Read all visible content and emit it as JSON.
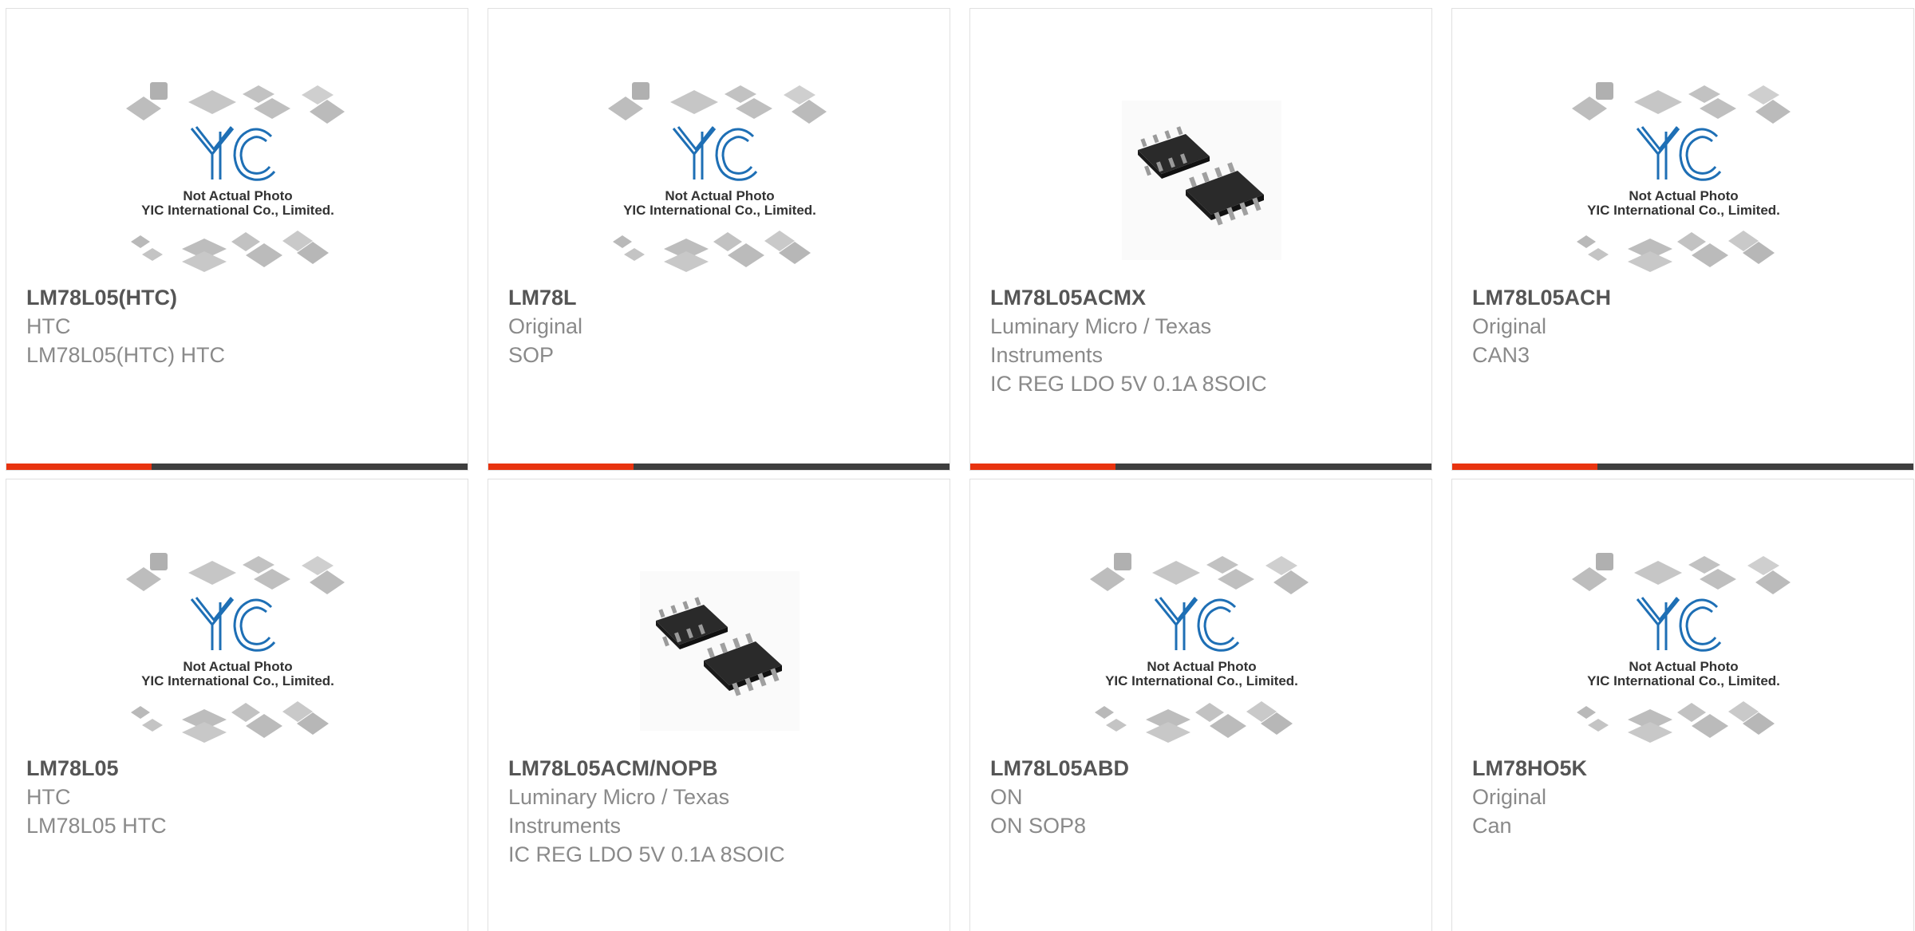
{
  "colors": {
    "accent": "#e8330f",
    "bar": "#3e3e3e",
    "title": "#555555",
    "text": "#8a8a8a",
    "yic_blue": "#1e6fb5"
  },
  "placeholder": {
    "line1": "Not Actual Photo",
    "line2": "YIC International Co., Limited.",
    "logo": "YIC"
  },
  "products": [
    {
      "part": "LM78L05(HTC)",
      "manufacturer": "HTC",
      "description": "LM78L05(HTC) HTC",
      "image": "placeholder"
    },
    {
      "part": "LM78L",
      "manufacturer": "Original",
      "description": "SOP",
      "image": "placeholder"
    },
    {
      "part": "LM78L05ACMX",
      "manufacturer": "Luminary Micro / Texas Instruments",
      "description": "IC REG LDO 5V 0.1A 8SOIC",
      "image": "soic"
    },
    {
      "part": "LM78L05ACH",
      "manufacturer": "Original",
      "description": "CAN3",
      "image": "placeholder"
    },
    {
      "part": "LM78L05",
      "manufacturer": "HTC",
      "description": "LM78L05 HTC",
      "image": "placeholder"
    },
    {
      "part": "LM78L05ACM/NOPB",
      "manufacturer": "Luminary Micro / Texas Instruments",
      "description": "IC REG LDO 5V 0.1A 8SOIC",
      "image": "soic"
    },
    {
      "part": "LM78L05ABD",
      "manufacturer": "ON",
      "description": "ON SOP8",
      "image": "placeholder"
    },
    {
      "part": "LM78HO5K",
      "manufacturer": "Original",
      "description": "Can",
      "image": "placeholder"
    }
  ]
}
